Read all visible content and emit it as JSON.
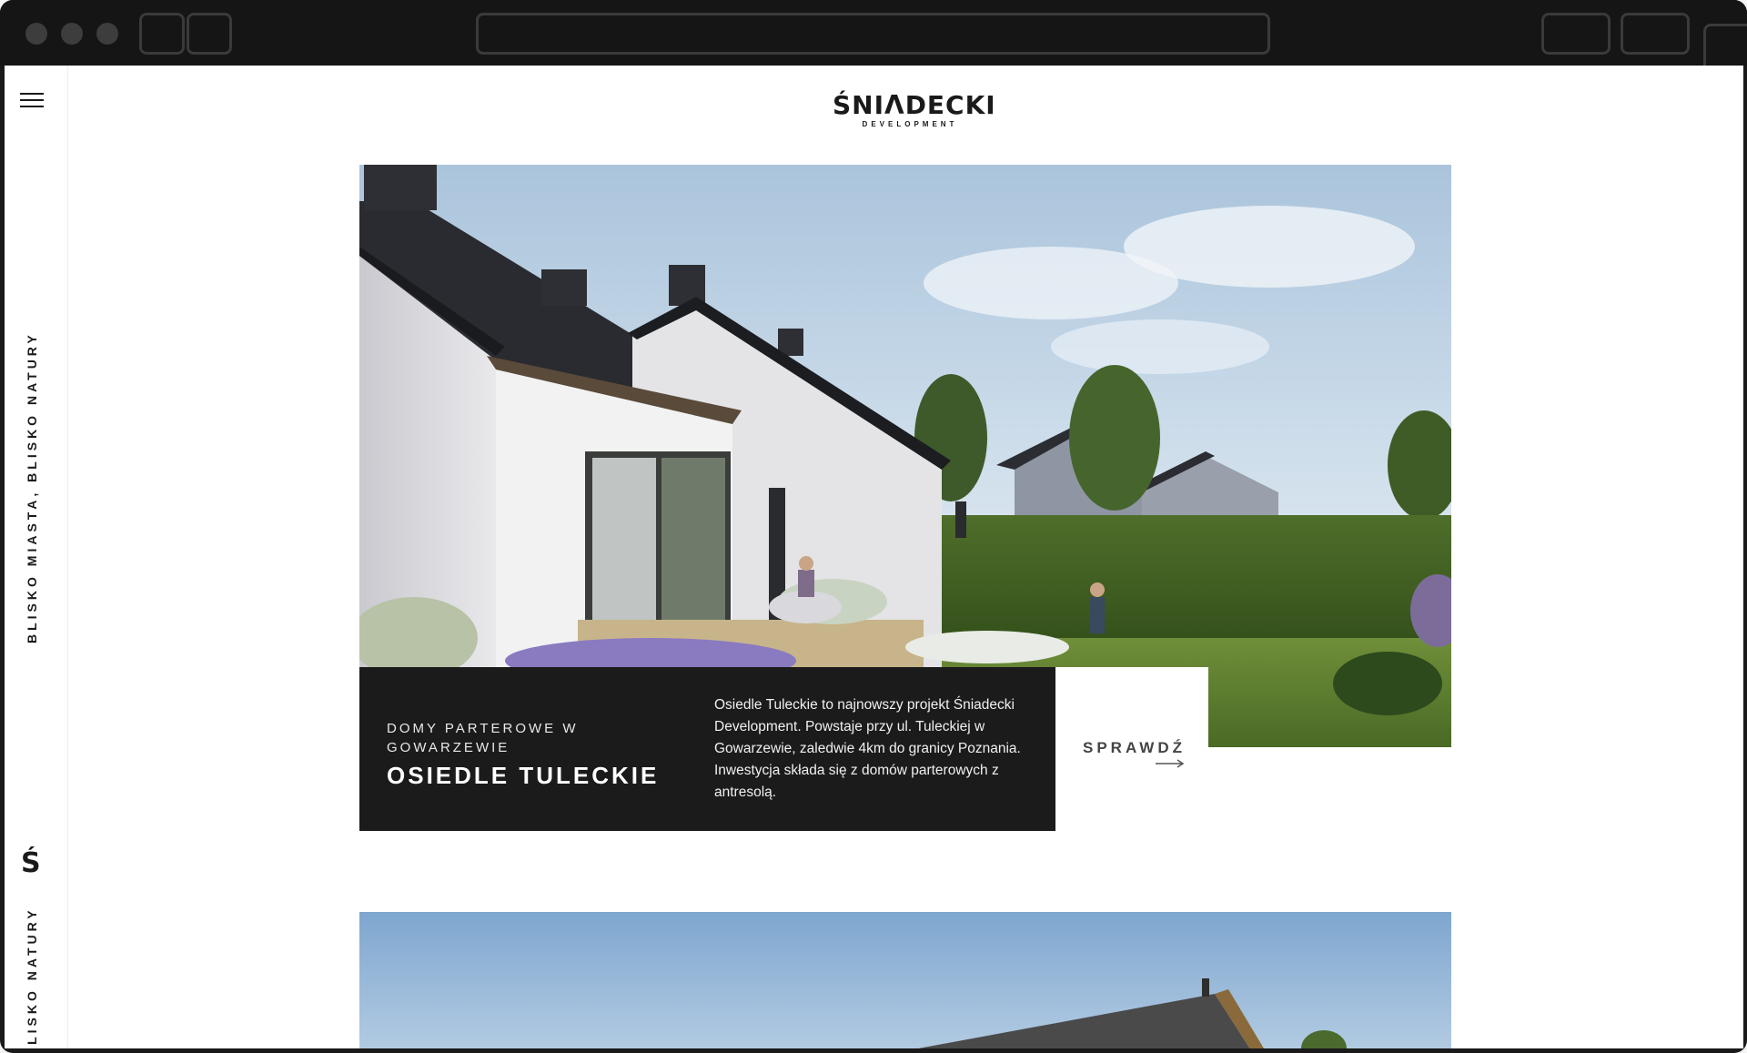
{
  "sidebar": {
    "menu_icon": "hamburger-menu-icon",
    "tagline": "BLISKO MIASTA, BLISKO NATURY",
    "tagline_repeat": "BLISKO NATURY",
    "logo_mark": "Ś"
  },
  "header": {
    "brand_name": "ŚNIΛDECKI",
    "brand_sub": "DEVELOPMENT"
  },
  "project": {
    "eyebrow": "DOMY PARTEROWE W GOWARZEWIE",
    "title": "OSIEDLE TULECKIE",
    "description": "Osiedle Tuleckie to najnowszy projekt Śniadecki Development. Powstaje przy ul. Tuleckiej w Gowarzewie, zaledwie 4km do granicy Poznania. Inwestycja składa się z domów parterowych z antresolą.",
    "cta_label": "SPRAWDŹ",
    "cta_icon": "arrow-right-icon"
  },
  "colors": {
    "card_bg": "#1b1b1b",
    "text_dark": "#1a1a1a",
    "chrome_bg": "#151515"
  }
}
